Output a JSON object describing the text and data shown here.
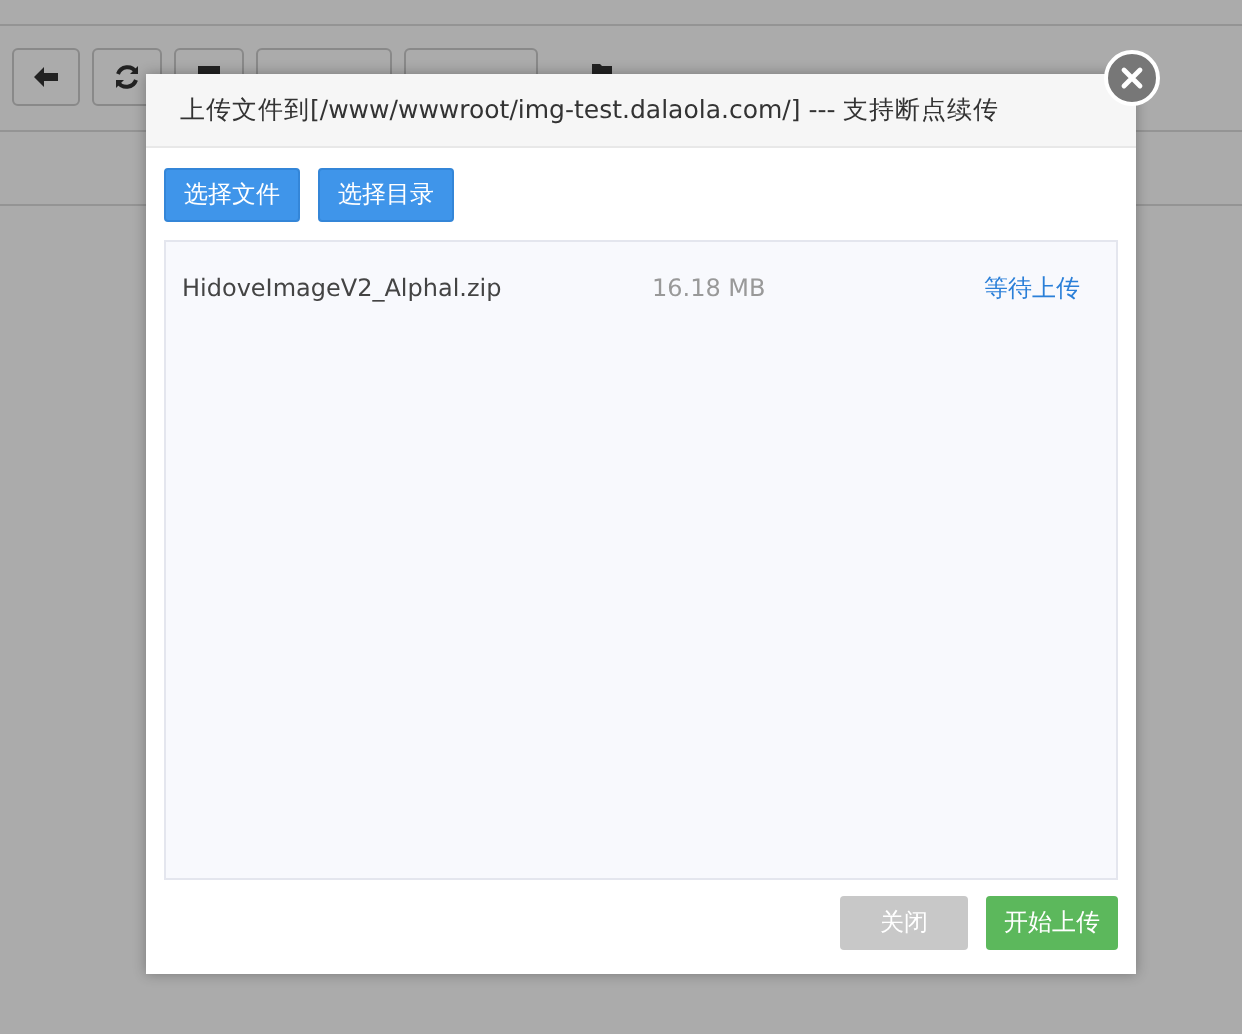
{
  "dialog": {
    "title": "上传文件到[/www/wwwroot/img-test.dalaola.com/] --- 支持断点续传",
    "pickers": [
      "选择文件",
      "选择目录"
    ],
    "files": [
      {
        "name": "HidoveImageV2_Alphal.zip",
        "size": "16.18 MB",
        "status": "等待上传"
      }
    ],
    "buttons": [
      {
        "label": "关闭",
        "kind": "close"
      },
      {
        "label": "开始上传",
        "kind": "start"
      }
    ]
  }
}
